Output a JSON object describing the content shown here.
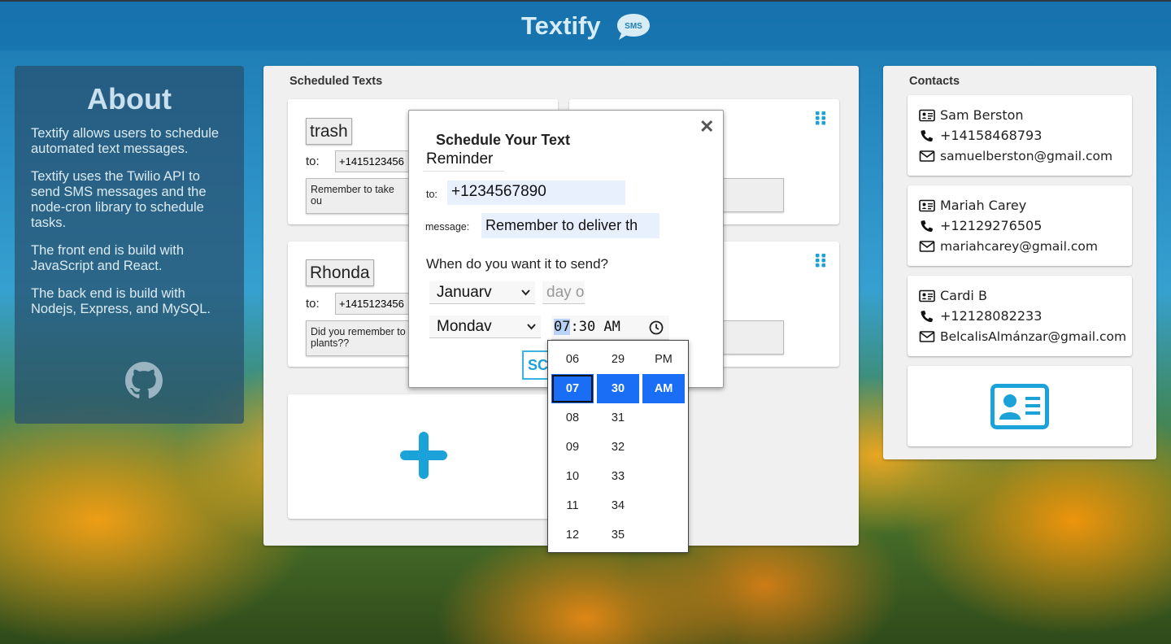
{
  "header": {
    "title": "Textify",
    "logo_text": "SMS"
  },
  "about": {
    "title": "About",
    "paragraphs": [
      "Textify allows users to schedule automated text messages.",
      "Textify uses the Twilio API to send SMS messages and the node-cron library to schedule tasks.",
      "The front end is build with JavaScript and React.",
      "The back end is build with Nodejs, Express, and MySQL."
    ]
  },
  "scheduled": {
    "heading": "Scheduled Texts",
    "cards": [
      {
        "name": "trash",
        "to_label": "to:",
        "phone": "+1415123456",
        "message": "Remember to take ou"
      },
      {
        "name": "Rhonda",
        "to_label": "to:",
        "phone": "+1415123456",
        "message": "Did you remember to plants??"
      }
    ]
  },
  "contacts": {
    "heading": "Contacts",
    "items": [
      {
        "name": "Sam Berston",
        "phone": "+14158468793",
        "email": "samuelberston@gmail.com"
      },
      {
        "name": "Mariah Carey",
        "phone": "+12129276505",
        "email": "mariahcarey@gmail.com"
      },
      {
        "name": "Cardi B",
        "phone": "+12128082233",
        "email": "BelcalisAlmánzar@gmail.com"
      }
    ]
  },
  "modal": {
    "title": "Schedule Your Text",
    "close_glyph": "✕",
    "title_value": "Reminder",
    "to_label": "to:",
    "to_value": "+1234567890",
    "message_label": "message:",
    "message_value": "Remember to deliver th",
    "when_label": "When do you want it to send?",
    "month_value": "Januarv",
    "day_placeholder": "day o",
    "weekday_value": "Mondav",
    "time_hour": "07",
    "time_rest": ":30 AM",
    "submit_label": "SC"
  },
  "time_picker": {
    "hours": [
      "06",
      "07",
      "08",
      "09",
      "10",
      "11",
      "12"
    ],
    "minutes": [
      "29",
      "30",
      "31",
      "32",
      "33",
      "34",
      "35"
    ],
    "periods": [
      "PM",
      "AM"
    ],
    "selected_hour": "07",
    "selected_minute": "30",
    "selected_period": "AM"
  },
  "colors": {
    "accent": "#1ba2d8",
    "picker_selected": "#1a6ef5",
    "panel_bg": "#f0f0f0"
  }
}
